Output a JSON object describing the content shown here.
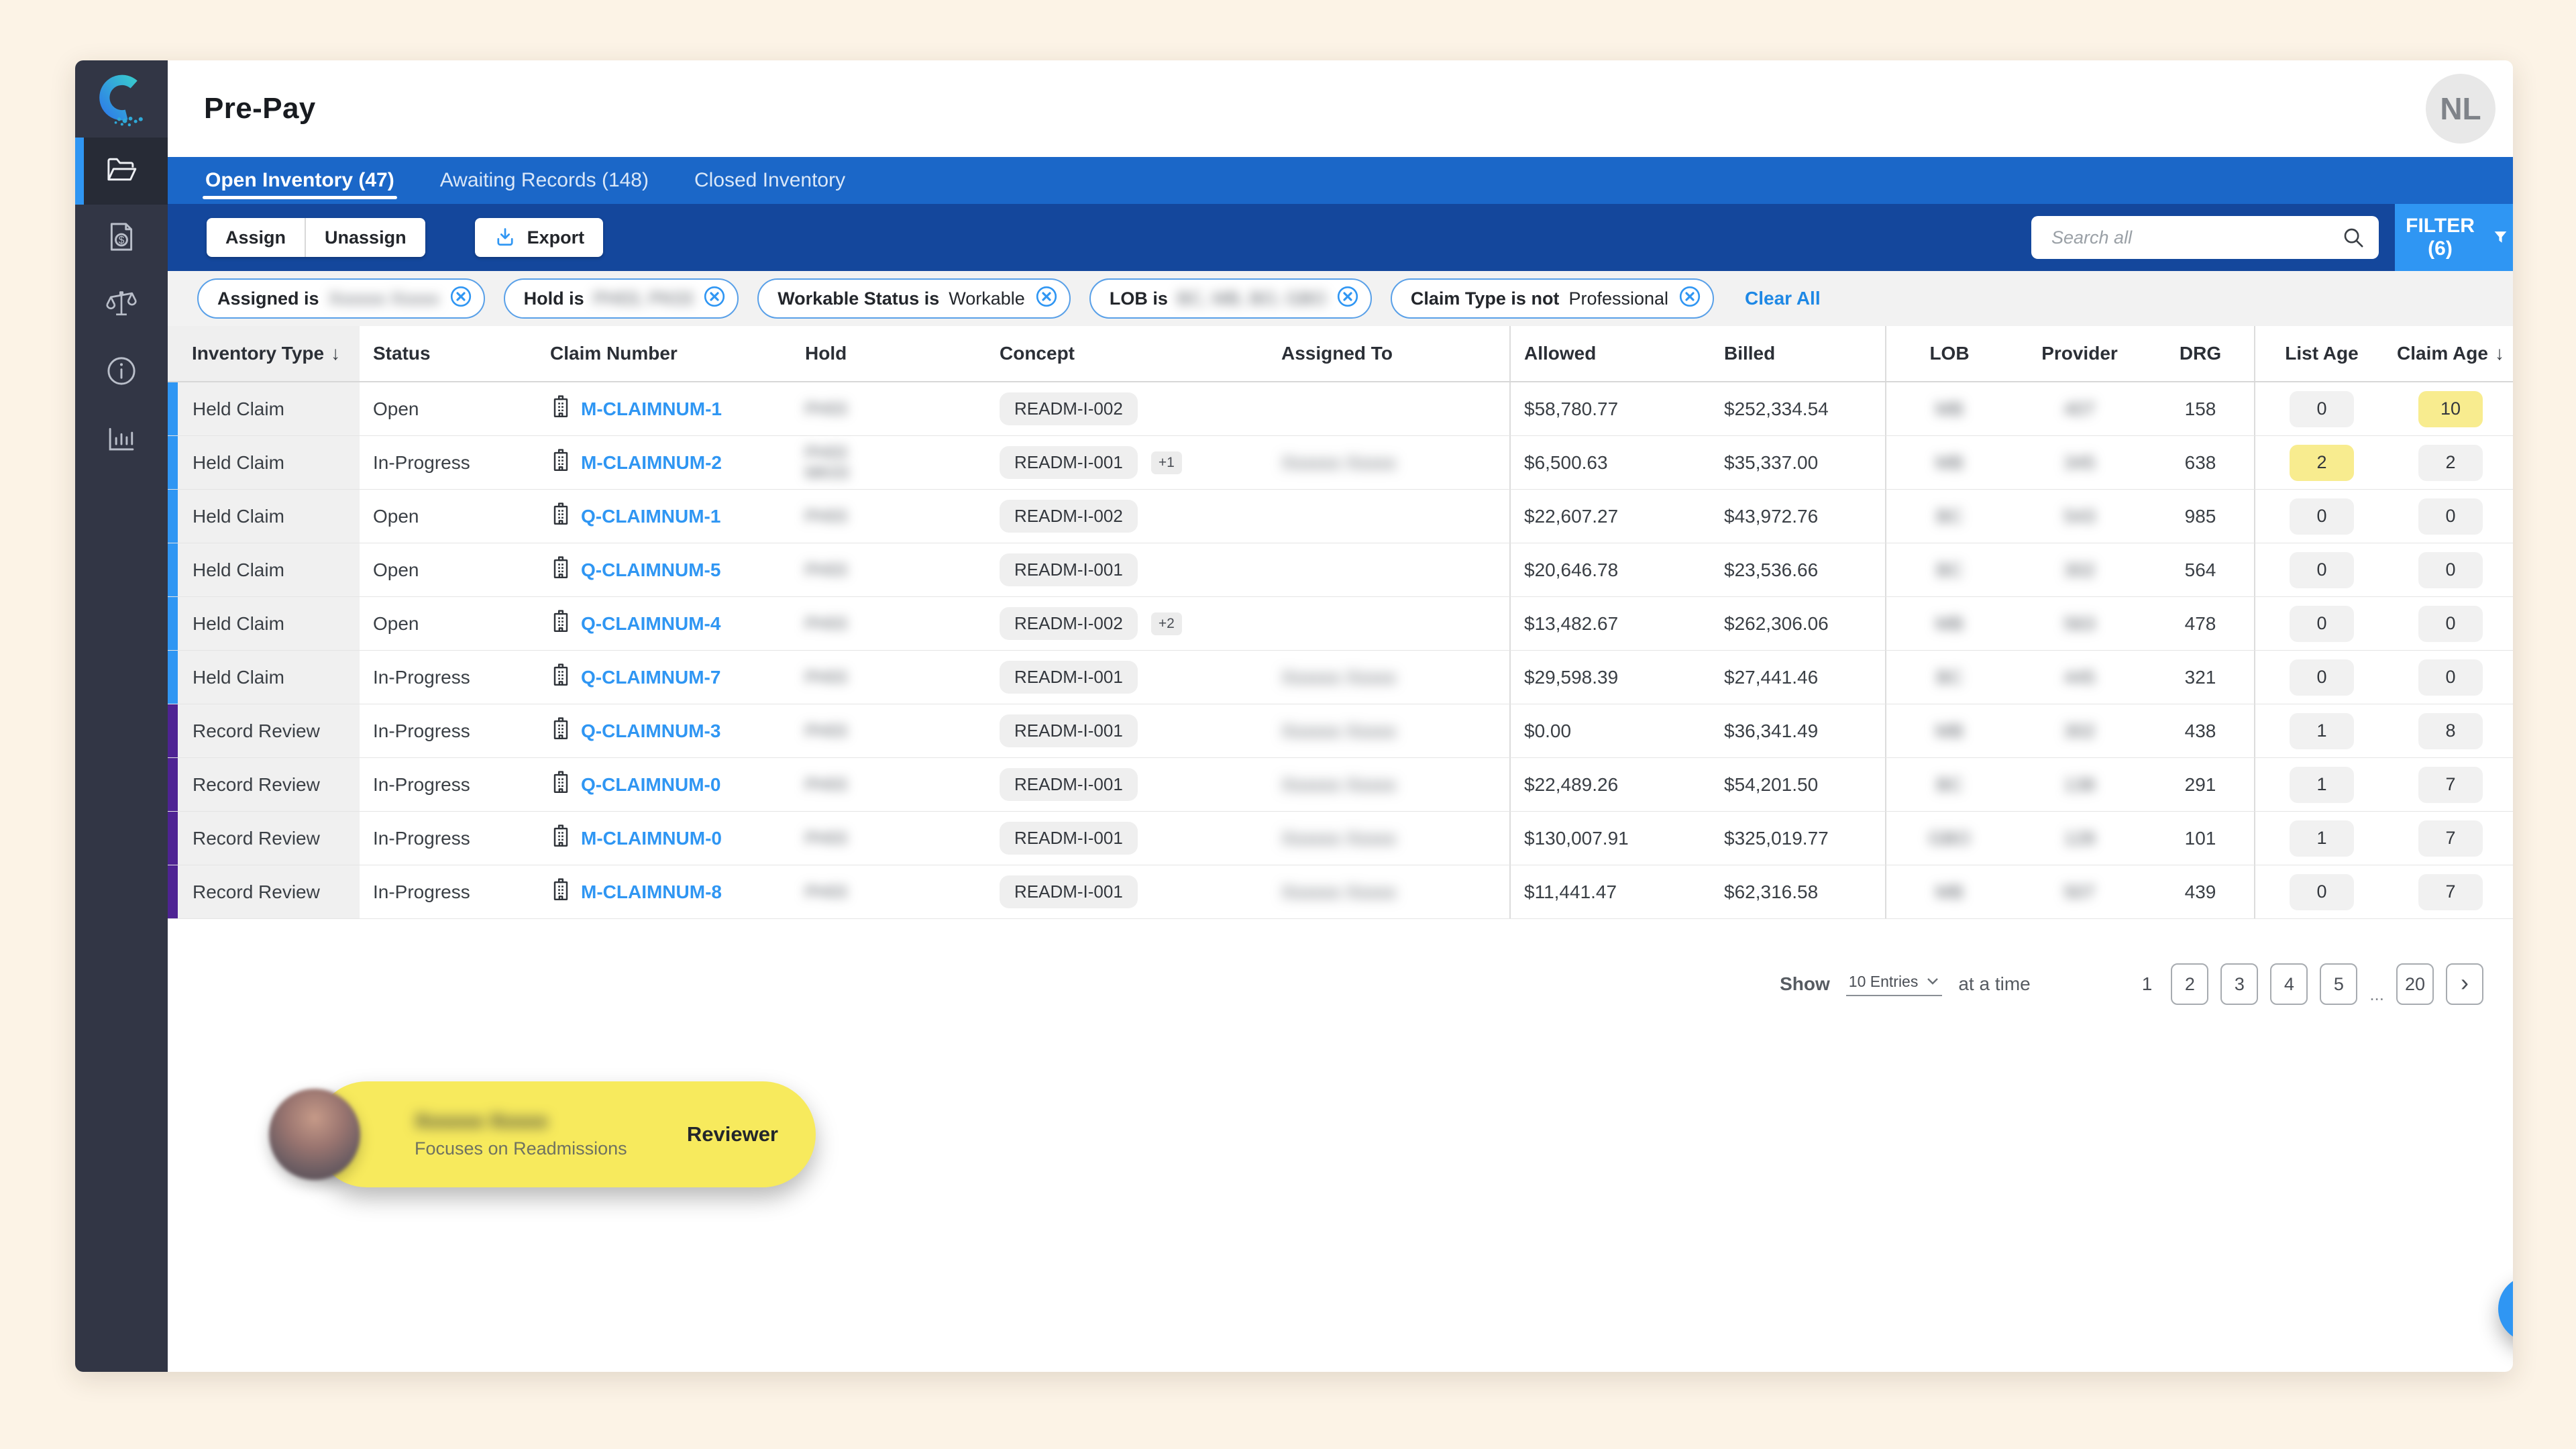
{
  "colors": {
    "accent": "#2F96F3",
    "held_bar": "#2F96F3",
    "record_bar": "#4E2393",
    "highlight_yellow": "#F8EC8F",
    "tooltip_yellow": "#F7EA5D",
    "tab_strip_blue": "#1B67C8",
    "toolbar_blue": "#14479C",
    "sidebar_dark": "#323645"
  },
  "sidebar": {
    "items": [
      {
        "icon": "folder-open-icon",
        "active": true
      },
      {
        "icon": "invoice-icon",
        "active": false
      },
      {
        "icon": "scales-icon",
        "active": false
      },
      {
        "icon": "info-icon",
        "active": false
      },
      {
        "icon": "bar-chart-icon",
        "active": false
      }
    ]
  },
  "header": {
    "title": "Pre-Pay",
    "avatar_initials": "NL"
  },
  "tabs": [
    {
      "label": "Open Inventory (47)",
      "active": true
    },
    {
      "label": "Awaiting Records (148)",
      "active": false
    },
    {
      "label": "Closed Inventory",
      "active": false
    }
  ],
  "toolbar": {
    "assign_label": "Assign",
    "unassign_label": "Unassign",
    "export_label": "Export",
    "search_placeholder": "Search all",
    "search_value": "",
    "filter_label": "FILTER (6)"
  },
  "filters": {
    "clear_all_label": "Clear All",
    "chips": [
      {
        "label": "Assigned is",
        "value": "Xxxxxx Xxxxx",
        "redacted": true
      },
      {
        "label": "Hold is",
        "value": "PH03, PK03",
        "redacted": true
      },
      {
        "label": "Workable Status is",
        "value": "Workable",
        "redacted": false
      },
      {
        "label": "LOB is",
        "value": "BC, MB, BO, GBO",
        "redacted": true
      },
      {
        "label": "Claim Type is not",
        "value": "Professional",
        "redacted": false
      }
    ]
  },
  "table": {
    "columns": [
      {
        "label": "Inventory Type",
        "sorted": "desc"
      },
      {
        "label": "Status"
      },
      {
        "label": "Claim Number"
      },
      {
        "label": "Hold"
      },
      {
        "label": "Concept"
      },
      {
        "label": "Assigned To"
      },
      {
        "label": "Allowed"
      },
      {
        "label": "Billed"
      },
      {
        "label": "LOB"
      },
      {
        "label": "Provider"
      },
      {
        "label": "DRG"
      },
      {
        "label": "List Age"
      },
      {
        "label": "Claim Age",
        "sorted": "desc"
      }
    ],
    "rows": [
      {
        "inventory_type": "Held Claim",
        "bar": "held",
        "status": "Open",
        "claim_number": "M-CLAIMNUM-1",
        "hold_redacted": [
          "PH03"
        ],
        "concept": "READM-I-002",
        "concept_extra": "",
        "assigned_redacted": "",
        "allowed": "$58,780.77",
        "billed": "$252,334.54",
        "lob_redacted": "MB",
        "provider_redacted": "407",
        "drg": "158",
        "list_age": "0",
        "list_age_hl": false,
        "claim_age": "10",
        "claim_age_hl": true
      },
      {
        "inventory_type": "Held Claim",
        "bar": "held",
        "status": "In-Progress",
        "claim_number": "M-CLAIMNUM-2",
        "hold_redacted": [
          "PH03",
          "MK03"
        ],
        "concept": "READM-I-001",
        "concept_extra": "+1",
        "assigned_redacted": "Xxxxxx Xxxxx",
        "allowed": "$6,500.63",
        "billed": "$35,337.00",
        "lob_redacted": "MB",
        "provider_redacted": "345",
        "drg": "638",
        "list_age": "2",
        "list_age_hl": true,
        "claim_age": "2",
        "claim_age_hl": false
      },
      {
        "inventory_type": "Held Claim",
        "bar": "held",
        "status": "Open",
        "claim_number": "Q-CLAIMNUM-1",
        "hold_redacted": [
          "PH03"
        ],
        "concept": "READM-I-002",
        "concept_extra": "",
        "assigned_redacted": "",
        "allowed": "$22,607.27",
        "billed": "$43,972.76",
        "lob_redacted": "BC",
        "provider_redacted": "543",
        "drg": "985",
        "list_age": "0",
        "list_age_hl": false,
        "claim_age": "0",
        "claim_age_hl": false
      },
      {
        "inventory_type": "Held Claim",
        "bar": "held",
        "status": "Open",
        "claim_number": "Q-CLAIMNUM-5",
        "hold_redacted": [
          "PH03"
        ],
        "concept": "READM-I-001",
        "concept_extra": "",
        "assigned_redacted": "",
        "allowed": "$20,646.78",
        "billed": "$23,536.66",
        "lob_redacted": "BC",
        "provider_redacted": "302",
        "drg": "564",
        "list_age": "0",
        "list_age_hl": false,
        "claim_age": "0",
        "claim_age_hl": false
      },
      {
        "inventory_type": "Held Claim",
        "bar": "held",
        "status": "Open",
        "claim_number": "Q-CLAIMNUM-4",
        "hold_redacted": [
          "PH03"
        ],
        "concept": "READM-I-002",
        "concept_extra": "+2",
        "assigned_redacted": "",
        "allowed": "$13,482.67",
        "billed": "$262,306.06",
        "lob_redacted": "MB",
        "provider_redacted": "563",
        "drg": "478",
        "list_age": "0",
        "list_age_hl": false,
        "claim_age": "0",
        "claim_age_hl": false
      },
      {
        "inventory_type": "Held Claim",
        "bar": "held",
        "status": "In-Progress",
        "claim_number": "Q-CLAIMNUM-7",
        "hold_redacted": [
          "PH03"
        ],
        "concept": "READM-I-001",
        "concept_extra": "",
        "assigned_redacted": "Xxxxxx Xxxxx",
        "allowed": "$29,598.39",
        "billed": "$27,441.46",
        "lob_redacted": "BC",
        "provider_redacted": "445",
        "drg": "321",
        "list_age": "0",
        "list_age_hl": false,
        "claim_age": "0",
        "claim_age_hl": false
      },
      {
        "inventory_type": "Record Review",
        "bar": "record",
        "status": "In-Progress",
        "claim_number": "Q-CLAIMNUM-3",
        "hold_redacted": [
          "PH03"
        ],
        "concept": "READM-I-001",
        "concept_extra": "",
        "assigned_redacted": "Xxxxxx Xxxxx",
        "allowed": "$0.00",
        "billed": "$36,341.49",
        "lob_redacted": "MB",
        "provider_redacted": "302",
        "drg": "438",
        "list_age": "1",
        "list_age_hl": false,
        "claim_age": "8",
        "claim_age_hl": false
      },
      {
        "inventory_type": "Record Review",
        "bar": "record",
        "status": "In-Progress",
        "claim_number": "Q-CLAIMNUM-0",
        "hold_redacted": [
          "PH03"
        ],
        "concept": "READM-I-001",
        "concept_extra": "",
        "assigned_redacted": "Xxxxxx Xxxxx",
        "allowed": "$22,489.26",
        "billed": "$54,201.50",
        "lob_redacted": "BC",
        "provider_redacted": "138",
        "drg": "291",
        "list_age": "1",
        "list_age_hl": false,
        "claim_age": "7",
        "claim_age_hl": false
      },
      {
        "inventory_type": "Record Review",
        "bar": "record",
        "status": "In-Progress",
        "claim_number": "M-CLAIMNUM-0",
        "hold_redacted": [
          "PH03"
        ],
        "concept": "READM-I-001",
        "concept_extra": "",
        "assigned_redacted": "Xxxxxx Xxxxx",
        "allowed": "$130,007.91",
        "billed": "$325,019.77",
        "lob_redacted": "GBO",
        "provider_redacted": "128",
        "drg": "101",
        "list_age": "1",
        "list_age_hl": false,
        "claim_age": "7",
        "claim_age_hl": false
      },
      {
        "inventory_type": "Record Review",
        "bar": "record",
        "status": "In-Progress",
        "claim_number": "M-CLAIMNUM-8",
        "hold_redacted": [
          "PH03"
        ],
        "concept": "READM-I-001",
        "concept_extra": "",
        "assigned_redacted": "Xxxxxx Xxxxx",
        "allowed": "$11,441.47",
        "billed": "$62,316.58",
        "lob_redacted": "MB",
        "provider_redacted": "507",
        "drg": "439",
        "list_age": "0",
        "list_age_hl": false,
        "claim_age": "7",
        "claim_age_hl": false
      }
    ]
  },
  "pagination": {
    "show_label": "Show",
    "entries_value": "10 Entries",
    "suffix_label": "at a time",
    "current_page": "1",
    "pages": [
      "2",
      "3",
      "4",
      "5"
    ],
    "ellipsis": "...",
    "last_page": "20",
    "next_label": "›"
  },
  "reviewer_card": {
    "name": "Xxxxxx Xxxxx",
    "name_redacted": true,
    "subtitle": "Focuses on Readmissions",
    "role": "Reviewer"
  }
}
